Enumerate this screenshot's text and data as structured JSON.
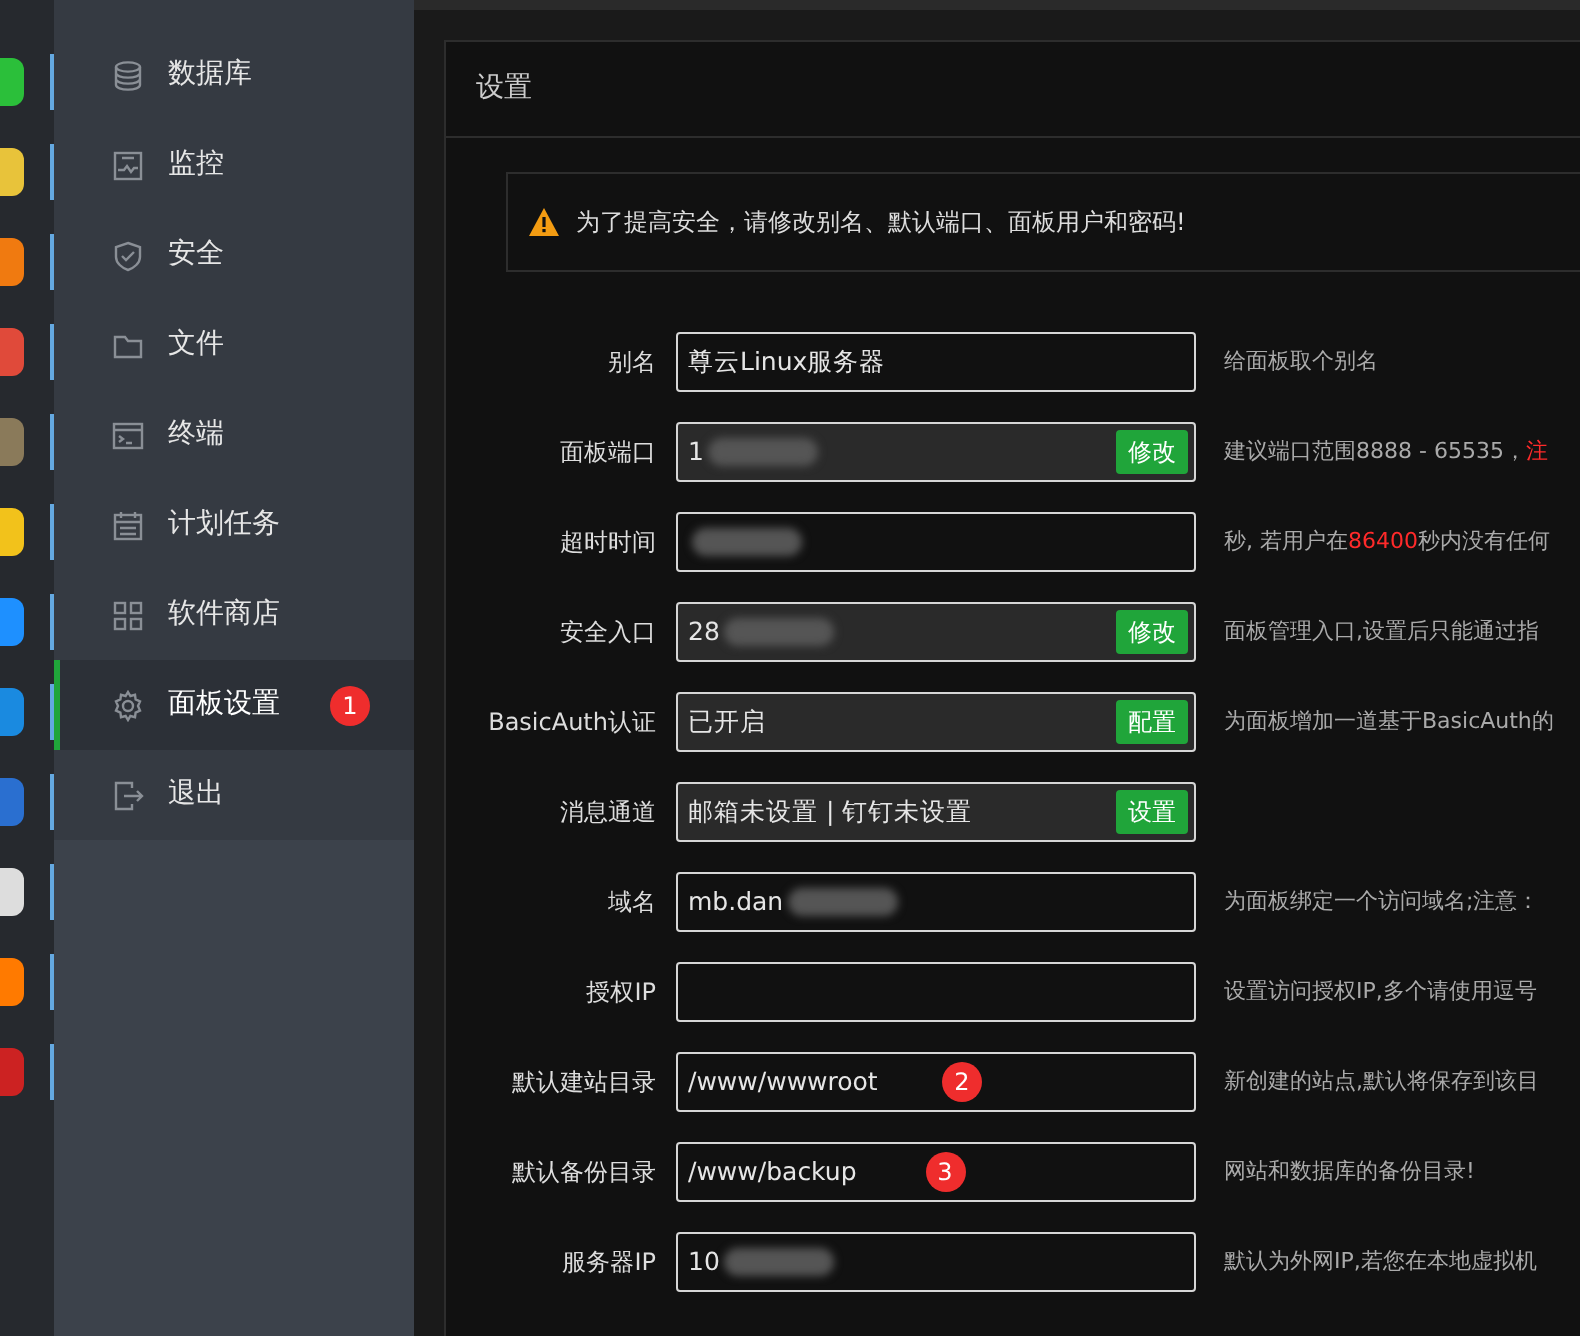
{
  "sidebar": {
    "items": [
      {
        "label": "数据库",
        "selected": false
      },
      {
        "label": "监控",
        "selected": false
      },
      {
        "label": "安全",
        "selected": false
      },
      {
        "label": "文件",
        "selected": false
      },
      {
        "label": "终端",
        "selected": false
      },
      {
        "label": "计划任务",
        "selected": false
      },
      {
        "label": "软件商店",
        "selected": false
      },
      {
        "label": "面板设置",
        "selected": true,
        "marker": "1"
      },
      {
        "label": "退出",
        "selected": false
      }
    ]
  },
  "panel": {
    "title": "设置",
    "alert": "为了提高安全，请修改别名、默认端口、面板用户和密码!",
    "rows": [
      {
        "label": "别名",
        "value": "尊云Linux服务器",
        "hint": [
          {
            "text": "给面板取个别名",
            "highlight": false
          }
        ]
      },
      {
        "label": "面板端口",
        "value": "1",
        "redacted": true,
        "button": "修改",
        "hint": [
          {
            "text": "建议端口范围8888 - 65535，",
            "highlight": false
          },
          {
            "text": "注",
            "highlight": true
          }
        ]
      },
      {
        "label": "超时时间",
        "redacted": true,
        "hint": [
          {
            "text": "秒, 若用户在",
            "highlight": false
          },
          {
            "text": "86400",
            "highlight": true
          },
          {
            "text": "秒内没有任何",
            "highlight": false
          }
        ]
      },
      {
        "label": "安全入口",
        "value": "28",
        "redacted": true,
        "button": "修改",
        "hint": [
          {
            "text": "面板管理入口,设置后只能通过指",
            "highlight": false
          }
        ]
      },
      {
        "label": "BasicAuth认证",
        "value": "已开启",
        "button": "配置",
        "hint": [
          {
            "text": "为面板增加一道基于BasicAuth的",
            "highlight": false
          }
        ]
      },
      {
        "label": "消息通道",
        "value": "邮箱未设置 | 钉钉未设置",
        "button": "设置"
      },
      {
        "label": "域名",
        "value": "mb.dan",
        "redacted": true,
        "hint": [
          {
            "text": "为面板绑定一个访问域名;注意：",
            "highlight": false
          }
        ]
      },
      {
        "label": "授权IP",
        "hint": [
          {
            "text": "设置访问授权IP,多个请使用逗号",
            "highlight": false
          }
        ]
      },
      {
        "label": "默认建站目录",
        "value": "/www/wwwroot",
        "marker": "2",
        "hint": [
          {
            "text": "新创建的站点,默认将保存到该目",
            "highlight": false
          }
        ]
      },
      {
        "label": "默认备份目录",
        "value": "/www/backup",
        "marker": "3",
        "hint": [
          {
            "text": "网站和数据库的备份目录!",
            "highlight": false
          }
        ]
      },
      {
        "label": "服务器IP",
        "value": "10",
        "redacted": true,
        "hint": [
          {
            "text": "默认为外网IP,若您在本地虚拟机",
            "highlight": false
          }
        ]
      }
    ]
  }
}
